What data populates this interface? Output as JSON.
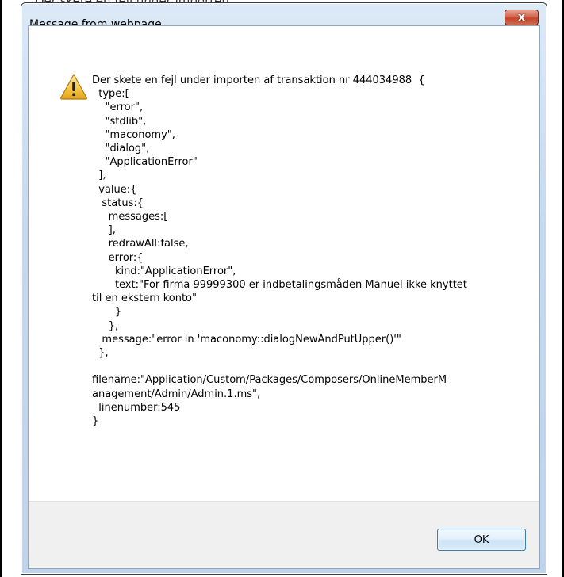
{
  "background": {
    "partial_text": "Der skete en fejl under importen"
  },
  "dialog": {
    "title": "Message from webpage",
    "close_glyph": "x",
    "icon": "warning-icon",
    "message": "Der skete en fejl under importen af transaktion nr 444034988  {\n  type:[\n    \"error\",\n    \"stdlib\",\n    \"maconomy\",\n    \"dialog\",\n    \"ApplicationError\"\n  ],\n  value:{\n   status:{\n     messages:[\n     ],\n     redrawAll:false,\n     error:{\n       kind:\"ApplicationError\",\n       text:\"For firma 99999300 er indbetalingsmåden Manuel ikke knyttet\ntil en ekstern konto\"\n       }\n     },\n   message:\"error in 'maconomy::dialogNewAndPutUpper()'\"\n  },\n\nfilename:\"Application/Custom/Packages/Composers/OnlineMemberM\nanagement/Admin/Admin.1.ms\",\n  linenumber:545\n}",
    "ok_label": "OK"
  },
  "colors": {
    "frame": "#c5d8ee",
    "close_button": "#c2452a",
    "footer": "#f0f0f0",
    "ok_border": "#3c7fb1",
    "warning_yellow": "#f5c542"
  }
}
